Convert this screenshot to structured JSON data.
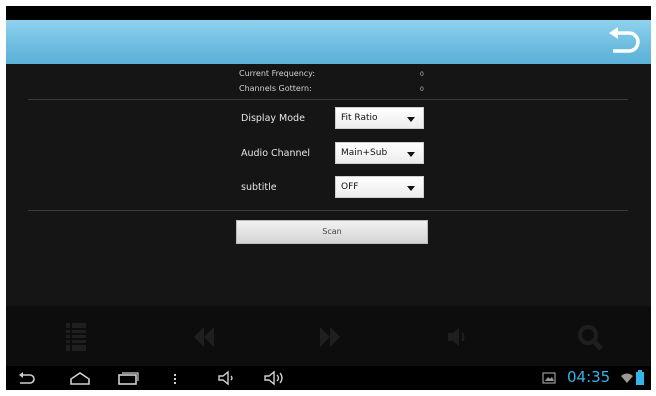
{
  "info": {
    "current_frequency_label": "Current Frequency:",
    "current_frequency_value": "0",
    "channels_gotten_label": "Channels Gottern:",
    "channels_gotten_value": "0"
  },
  "settings": [
    {
      "label": "Display Mode",
      "value": "Fit Ratio"
    },
    {
      "label": "Audio Channel",
      "value": "Main+Sub"
    },
    {
      "label": "subtitle",
      "value": "OFF"
    }
  ],
  "scan_label": "Scan",
  "status": {
    "time": "04:35"
  },
  "icons": {
    "back": "back-arrow-icon",
    "controls": [
      "channel-list-icon",
      "previous-icon",
      "next-icon",
      "volume-icon",
      "search-icon"
    ],
    "nav": [
      "nav-back-icon",
      "nav-home-icon",
      "nav-recents-icon",
      "nav-menu-icon",
      "volume-down-icon",
      "volume-up-icon"
    ],
    "status": [
      "gallery-icon",
      "wifi-icon",
      "battery-icon"
    ]
  },
  "colors": {
    "accent": "#33b5e5",
    "titlebar": "#6cbcdf"
  }
}
